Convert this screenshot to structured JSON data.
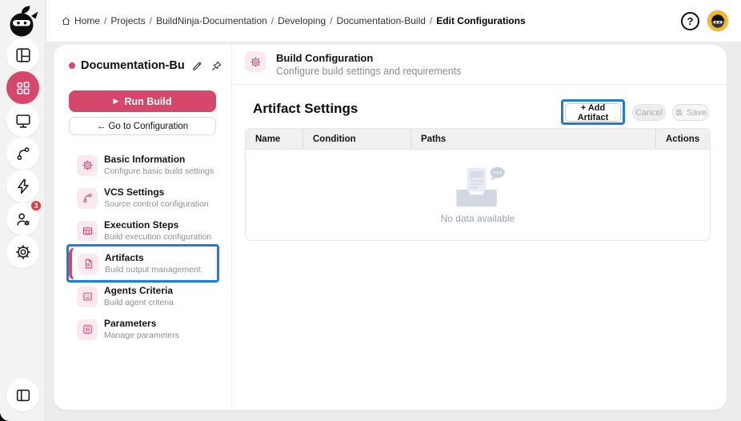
{
  "colors": {
    "accent": "#d5476b",
    "annotation_blue": "#1d7ed3",
    "badge_red": "#e23c3c",
    "avatar_bg": "#f2b827",
    "icon_bg_pink": "#fbe9ef"
  },
  "breadcrumb": {
    "separator": "/",
    "items": [
      "Home",
      "Projects",
      "BuildNinja-Documentation",
      "Developing",
      "Documentation-Build",
      "Edit Configurations"
    ]
  },
  "topbar": {
    "help_glyph": "?"
  },
  "sidebar": {
    "badge_count": "3",
    "items": [
      {
        "icon": "layout-dashboard-icon",
        "active": false
      },
      {
        "icon": "apps-grid-icon",
        "active": true
      },
      {
        "icon": "monitor-icon",
        "active": false
      },
      {
        "icon": "git-branch-icon",
        "active": false
      },
      {
        "icon": "lightning-icon",
        "active": false
      },
      {
        "icon": "user-settings-icon",
        "active": false,
        "badge": "3"
      },
      {
        "icon": "settings-gear-icon",
        "active": false
      },
      {
        "icon": "collapse-panel-icon",
        "active": false
      }
    ]
  },
  "panel": {
    "title": "Documentation-Bu...",
    "run_build_glyph": "▶",
    "run_build_label": "Run Build",
    "goto_configuration_label": "← Go to Configuration",
    "nav": [
      {
        "label": "Basic Information",
        "desc": "Configure basic build settings",
        "icon": "gear-icon"
      },
      {
        "label": "VCS Settings",
        "desc": "Source control configuration",
        "icon": "git-branch-icon"
      },
      {
        "label": "Execution Steps",
        "desc": "Build execution configuration",
        "icon": "table-icon"
      },
      {
        "label": "Artifacts",
        "desc": "Build output management",
        "icon": "file-icon",
        "active": true,
        "highlighted": true
      },
      {
        "label": "Agents Criteria",
        "desc": "Build agent criteria",
        "icon": "robot-icon"
      },
      {
        "label": "Parameters",
        "desc": "Manage parameters",
        "icon": "sliders-icon"
      }
    ]
  },
  "main": {
    "header": {
      "title": "Build Configuration",
      "subtitle": "Configure build settings and requirements"
    },
    "section_title": "Artifact Settings",
    "add_artifact_label": "+ Add Artifact",
    "cancel_label": "Cancel",
    "save_label": "Save",
    "table": {
      "columns": [
        "Name",
        "Condition",
        "Paths",
        "Actions"
      ],
      "rows": [],
      "empty_text": "No data available"
    }
  }
}
